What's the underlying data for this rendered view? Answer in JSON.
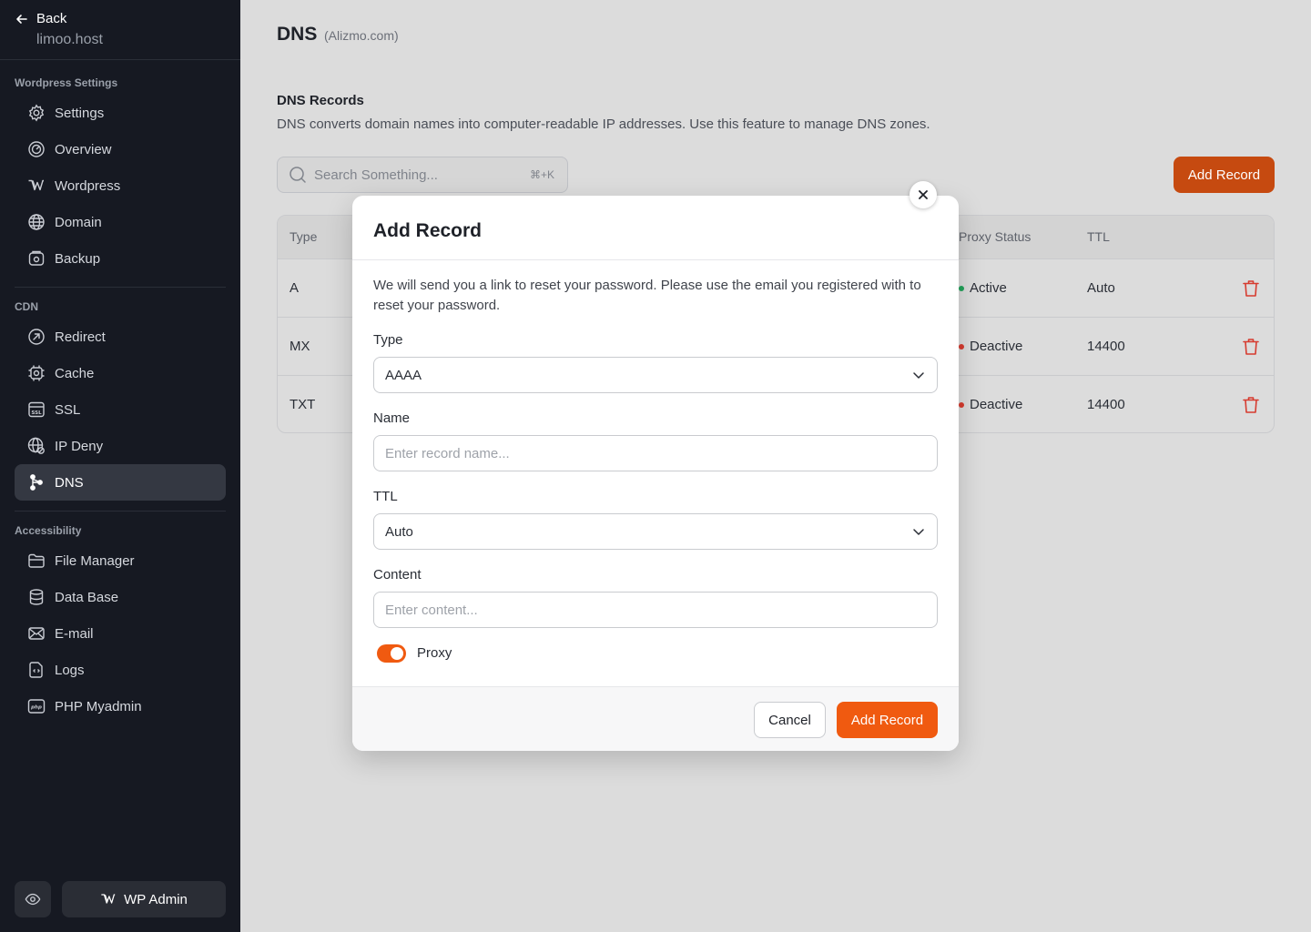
{
  "sidebar": {
    "back_label": "Back",
    "host": "limoo.host",
    "sections": [
      {
        "title": "Wordpress Settings",
        "items": [
          {
            "label": "Settings",
            "icon": "gear-icon"
          },
          {
            "label": "Overview",
            "icon": "gauge-icon"
          },
          {
            "label": "Wordpress",
            "icon": "wordpress-icon"
          },
          {
            "label": "Domain",
            "icon": "globe-icon"
          },
          {
            "label": "Backup",
            "icon": "backup-icon"
          }
        ]
      },
      {
        "title": "CDN",
        "items": [
          {
            "label": "Redirect",
            "icon": "redirect-icon"
          },
          {
            "label": "Cache",
            "icon": "chip-icon"
          },
          {
            "label": "SSL",
            "icon": "ssl-icon"
          },
          {
            "label": "IP Deny",
            "icon": "ip-deny-icon"
          },
          {
            "label": "DNS",
            "icon": "dns-icon",
            "active": true
          }
        ]
      },
      {
        "title": "Accessibility",
        "items": [
          {
            "label": "File Manager",
            "icon": "folder-icon"
          },
          {
            "label": "Data Base",
            "icon": "database-icon"
          },
          {
            "label": "E-mail",
            "icon": "mail-icon"
          },
          {
            "label": "Logs",
            "icon": "log-file-icon"
          },
          {
            "label": "PHP Myadmin",
            "icon": "php-icon"
          }
        ]
      }
    ],
    "wp_admin_label": "WP Admin"
  },
  "main": {
    "title": "DNS",
    "subtitle": "(Alizmo.com)",
    "records_title": "DNS Records",
    "records_desc": "DNS converts domain names into computer-readable IP addresses. Use this feature to manage DNS zones.",
    "search_placeholder": "Search Something...",
    "search_shortcut": "⌘+K",
    "add_record_label": "Add Record",
    "table": {
      "headers": {
        "type": "Type",
        "proxy_status": "Proxy Status",
        "ttl": "TTL"
      },
      "rows": [
        {
          "type": "A",
          "status": "Active",
          "status_color": "#22a35a",
          "ttl": "Auto"
        },
        {
          "type": "MX",
          "status": "Deactive",
          "status_color": "#d63b2f",
          "ttl": "14400"
        },
        {
          "type": "TXT",
          "status": "Deactive",
          "status_color": "#d63b2f",
          "ttl": "14400"
        }
      ]
    }
  },
  "modal": {
    "title": "Add Record",
    "description": "We will send you a link to reset your password. Please use the email you registered with to reset your password.",
    "type_label": "Type",
    "type_value": "AAAA",
    "name_label": "Name",
    "name_placeholder": "Enter record name...",
    "ttl_label": "TTL",
    "ttl_value": "Auto",
    "content_label": "Content",
    "content_placeholder": "Enter content...",
    "proxy_label": "Proxy",
    "proxy_on": true,
    "cancel_label": "Cancel",
    "submit_label": "Add Record"
  },
  "colors": {
    "accent": "#f05a10",
    "sidebar_bg": "#161922",
    "danger": "#d63b2f",
    "success": "#22a35a"
  }
}
